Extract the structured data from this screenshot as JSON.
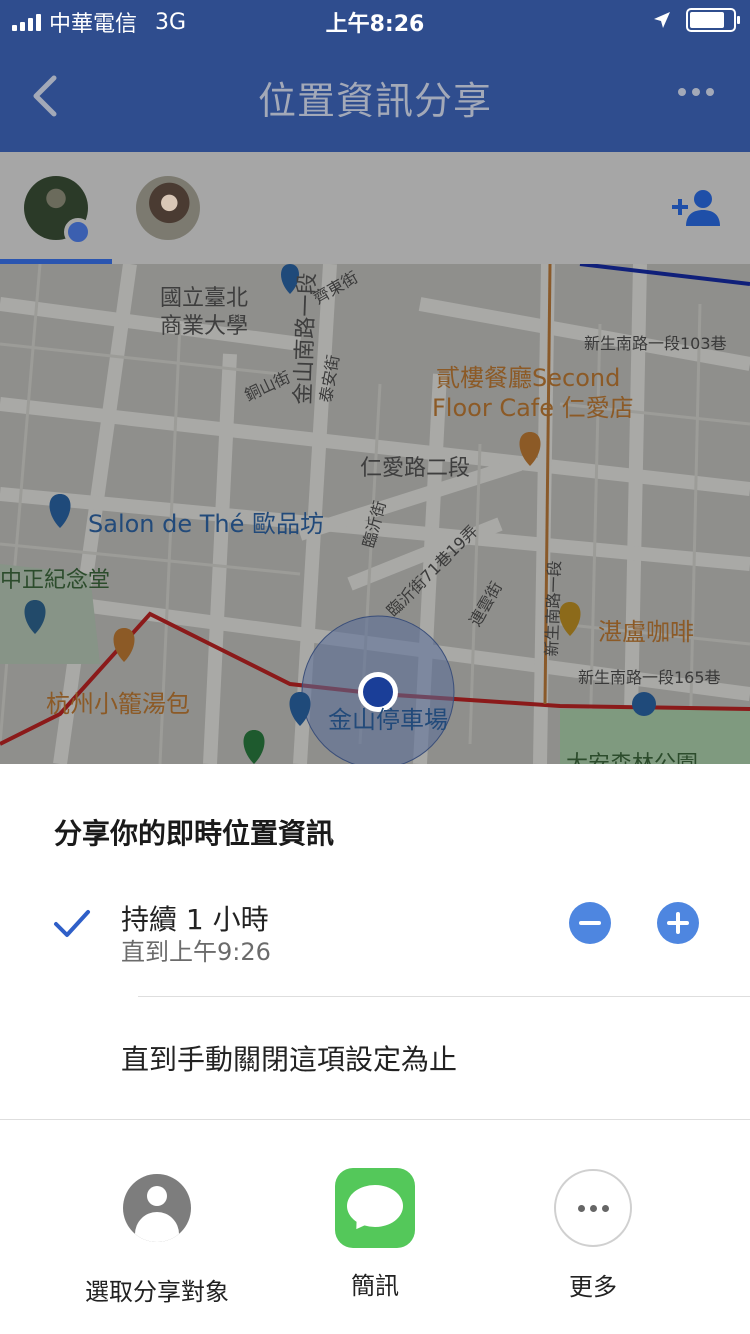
{
  "status_bar": {
    "carrier": "中華電信",
    "network": "3G",
    "time": "上午8:26"
  },
  "header": {
    "title": "位置資訊分享"
  },
  "map": {
    "labels": [
      "國立臺北",
      "商業大學",
      "貳樓餐廳Second",
      "Floor Cafe 仁愛店",
      "新生南路一段103巷",
      "Salon de Thé 歐品坊",
      "仁愛路二段",
      "中正紀念堂",
      "湛盧咖啡",
      "新生南路一段165巷",
      "杭州小籠湯包",
      "金山停車場",
      "大安森林公園",
      "金山南路一段",
      "新生南路一段",
      "臨沂街",
      "臨沂街71巷19弄",
      "連雲街",
      "泰安街",
      "銅山街",
      "齊東街"
    ]
  },
  "sheet": {
    "title": "分享你的即時位置資訊",
    "option_duration_label": "持續 1 小時",
    "option_duration_until": "直到上午9:26",
    "option_manual_label": "直到手動關閉這項設定為止",
    "share_targets": [
      {
        "label": "選取分享對象"
      },
      {
        "label": "簡訊"
      },
      {
        "label": "更多"
      }
    ]
  },
  "colors": {
    "header_bg": "#2f4d8e",
    "accent_blue": "#4e86e0",
    "sms_green": "#54c85a",
    "route_red": "#8b1a1a"
  },
  "icons": {
    "back": "chevron-left-icon",
    "more": "more-horizontal-icon",
    "add_person": "add-person-icon",
    "check": "check-icon",
    "minus": "minus-icon",
    "plus": "plus-icon",
    "contacts": "person-icon",
    "sms": "message-bubble-icon",
    "share_more": "more-dots-icon"
  }
}
